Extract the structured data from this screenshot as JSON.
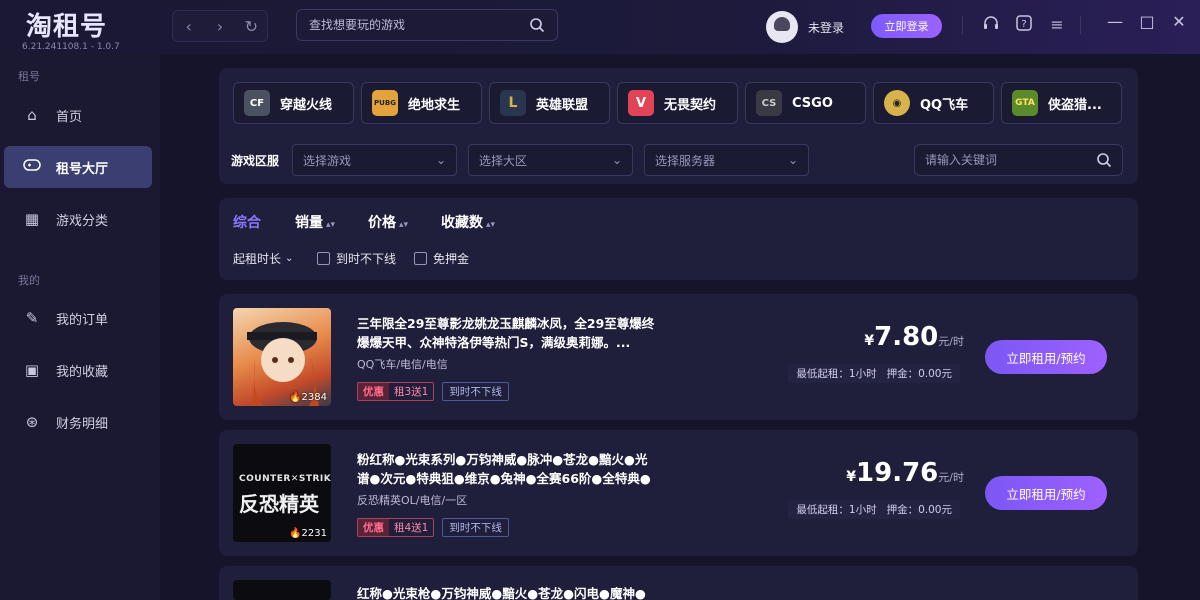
{
  "app": {
    "logo": "淘租号",
    "version": "6.21.241108.1 - 1.0.7"
  },
  "topbar": {
    "search_placeholder": "查找想要玩的游戏",
    "user_name": "未登录",
    "login_label": "立即登录"
  },
  "sidebar": {
    "section_rent": "租号",
    "section_mine": "我的",
    "items": [
      {
        "label": "首页",
        "icon": "home-icon"
      },
      {
        "label": "租号大厅",
        "icon": "gamepad-icon"
      },
      {
        "label": "游戏分类",
        "icon": "grid-icon"
      },
      {
        "label": "我的订单",
        "icon": "wrench-icon"
      },
      {
        "label": "我的收藏",
        "icon": "bookmark-icon"
      },
      {
        "label": "财务明细",
        "icon": "yen-icon"
      }
    ]
  },
  "games": [
    {
      "label": "穿越火线",
      "color": "#4a5262"
    },
    {
      "label": "绝地求生",
      "color": "#e3a23b"
    },
    {
      "label": "英雄联盟",
      "color": "#2a3550"
    },
    {
      "label": "无畏契约",
      "color": "#e04456"
    },
    {
      "label": "CSGO",
      "color": "#3a3a44"
    },
    {
      "label": "QQ飞车",
      "color": "#d8b24a"
    },
    {
      "label": "侠盗猎...",
      "color": "#5a8a2a"
    }
  ],
  "filters": {
    "zone_label": "游戏区服",
    "select_game": "选择游戏",
    "select_region": "选择大区",
    "select_server": "选择服务器",
    "keyword_placeholder": "请输入关键词"
  },
  "sort": {
    "items": [
      "综合",
      "销量",
      "价格",
      "收藏数"
    ],
    "duration": "起租时长",
    "no_offline": "到时不下线",
    "no_deposit": "免押金"
  },
  "listings": [
    {
      "title": "三年限全29至尊影龙姚龙玉麒麟冰凤，全29至尊爆终爆爆天甲、众神特洛伊等热门S，满级奥莉娜。...",
      "sub": "QQ飞车/电信/电信",
      "hot_tag": "优惠",
      "promo_tag": "租3送1",
      "plain_tag": "到时不下线",
      "currency": "¥",
      "price": "7.80",
      "unit": "元/时",
      "min_rent": "最低起租：1小时",
      "deposit": "押金：0.00元",
      "button": "立即租用/预约",
      "count": "2384"
    },
    {
      "title": "粉红称●光束系列●万钧神威●脉冲●苍龙●黯火●光谱●次元●特典狙●维京●兔神●全赛66阶●全特典●",
      "sub": "反恐精英OL/电信/一区",
      "hot_tag": "优惠",
      "promo_tag": "租4送1",
      "plain_tag": "到时不下线",
      "currency": "¥",
      "price": "19.76",
      "unit": "元/时",
      "min_rent": "最低起租：1小时",
      "deposit": "押金：0.00元",
      "button": "立即租用/预约",
      "count": "2231",
      "thumb_text": "反恐精英"
    },
    {
      "title": "红称●光束枪●万钧神威●黯火●苍龙●闪电●魔神●次"
    }
  ]
}
